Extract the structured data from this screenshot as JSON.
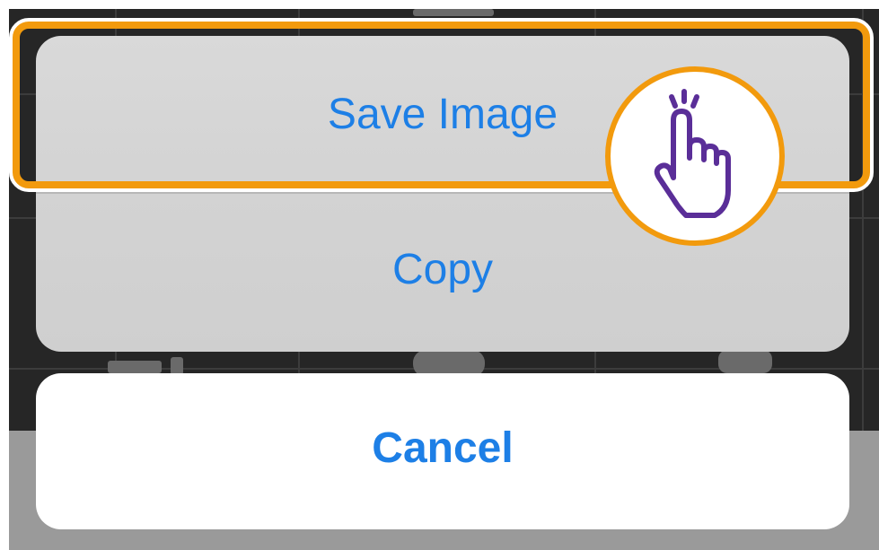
{
  "action_sheet": {
    "actions": [
      {
        "label": "Save Image"
      },
      {
        "label": "Copy"
      }
    ],
    "cancel_label": "Cancel"
  },
  "colors": {
    "action_text": "#1d7fe6",
    "highlight": "#f29a0d",
    "pointer": "#5a2e98",
    "sheet_background": "#d5d5d5",
    "backdrop": "#262626"
  },
  "icons": {
    "tap_indicator": "pointing-hand-tap-icon"
  }
}
